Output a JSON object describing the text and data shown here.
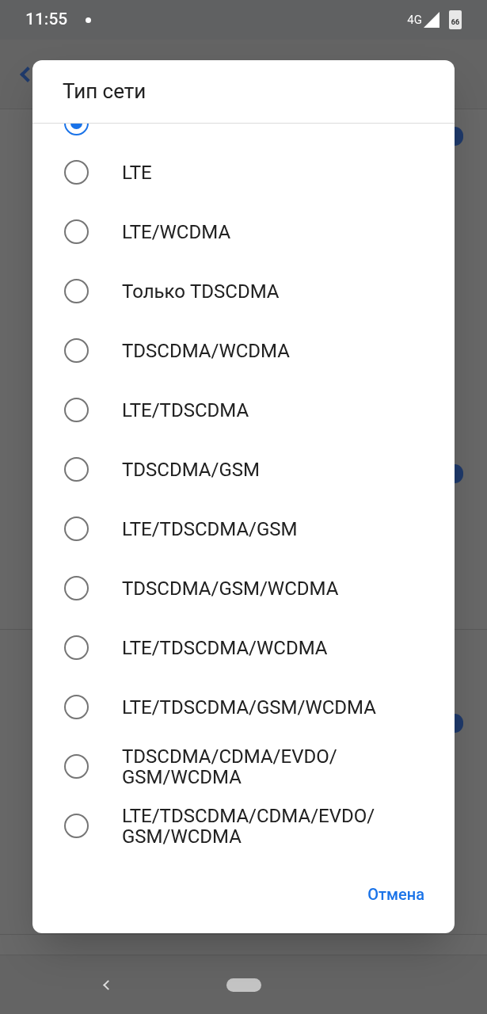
{
  "status_bar": {
    "time": "11:55",
    "network": "4G",
    "battery": "66"
  },
  "dialog": {
    "title": "Тип сети",
    "scrolled_item": {
      "selected": true
    },
    "options": [
      {
        "label": "LTE",
        "selected": false
      },
      {
        "label": "LTE/WCDMA",
        "selected": false
      },
      {
        "label": "Только TDSCDMA",
        "selected": false
      },
      {
        "label": "TDSCDMA/WCDMA",
        "selected": false
      },
      {
        "label": "LTE/TDSCDMA",
        "selected": false
      },
      {
        "label": "TDSCDMA/GSM",
        "selected": false
      },
      {
        "label": "LTE/TDSCDMA/GSM",
        "selected": false
      },
      {
        "label": "TDSCDMA/GSM/WCDMA",
        "selected": false
      },
      {
        "label": "LTE/TDSCDMA/WCDMA",
        "selected": false
      },
      {
        "label": "LTE/TDSCDMA/GSM/WCDMA",
        "selected": false
      },
      {
        "label": "TDSCDMA/CDMA/EVDO/ GSM/WCDMA",
        "selected": false
      },
      {
        "label": "LTE/TDSCDMA/CDMA/EVDO/ GSM/WCDMA",
        "selected": false
      }
    ],
    "cancel_button": "Отмена"
  }
}
